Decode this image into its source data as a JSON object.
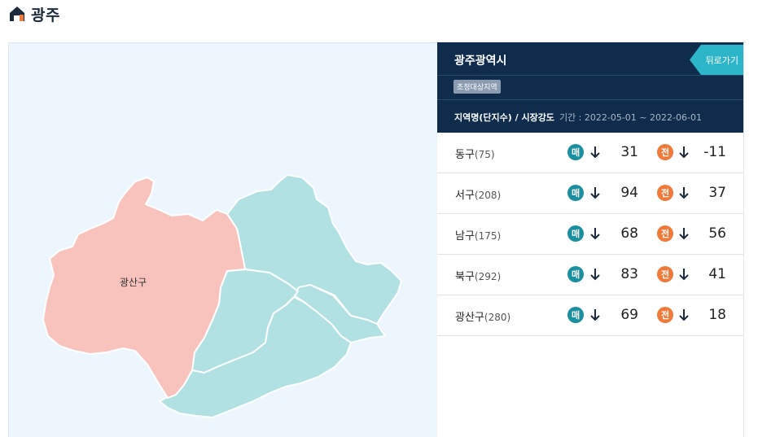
{
  "page": {
    "title": "광주"
  },
  "map": {
    "highlight_label": "광산구",
    "colors": {
      "highlight": "#f9c3bd",
      "other": "#b1e1e3",
      "border": "#ffffff"
    }
  },
  "panel": {
    "region_title": "광주광역시",
    "back_label": "뒤로가기",
    "status_badge": "조정대상지역",
    "filter_label": "지역명(단지수) / 시장강도",
    "period": "기간 : 2022-05-01 ~ 2022-06-01",
    "sale_chip": "매",
    "jeonse_chip": "전",
    "rows": [
      {
        "name": "동구",
        "count": "(75)",
        "sale_trend": "down",
        "sale_value": "31",
        "jeonse_trend": "down",
        "jeonse_value": "-11"
      },
      {
        "name": "서구",
        "count": "(208)",
        "sale_trend": "down",
        "sale_value": "94",
        "jeonse_trend": "down",
        "jeonse_value": "37"
      },
      {
        "name": "남구",
        "count": "(175)",
        "sale_trend": "down",
        "sale_value": "68",
        "jeonse_trend": "down",
        "jeonse_value": "56"
      },
      {
        "name": "북구",
        "count": "(292)",
        "sale_trend": "down",
        "sale_value": "83",
        "jeonse_trend": "down",
        "jeonse_value": "41"
      },
      {
        "name": "광산구",
        "count": "(280)",
        "sale_trend": "down",
        "sale_value": "69",
        "jeonse_trend": "down",
        "jeonse_value": "18"
      }
    ],
    "colors": {
      "header_bg": "#0f2c4c",
      "back_bg": "#2db5c9",
      "sale": "#1a8fa0",
      "jeonse": "#f07a3c"
    }
  }
}
